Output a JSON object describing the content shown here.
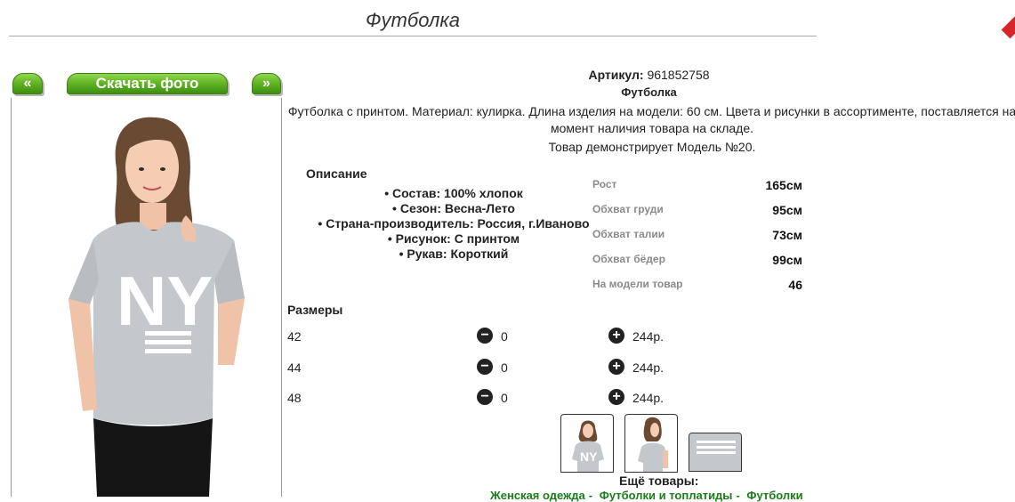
{
  "page": {
    "title": "Футболка"
  },
  "gallery": {
    "prev_label": "«",
    "download_label": "Скачать фото",
    "next_label": "»"
  },
  "product": {
    "article_label": "Артикул:",
    "article_value": "961852758",
    "name": "Футболка",
    "description": "Футболка с принтом. Материал: кулирка. Длина изделия на модели: 60 см. Цвета и рисунки в ассортименте, поставляется на момент наличия товара на складе.",
    "model_note": "Товар демонстрирует Модель №20."
  },
  "details": {
    "title": "Описание",
    "features": [
      "Состав: 100% хлопок",
      "Сезон: Весна-Лето",
      "Страна-производитель: Россия, г.Иваново",
      "Рисунок: С принтом",
      "Рукав: Короткий"
    ]
  },
  "measurements": [
    {
      "label": "Рост",
      "value": "165см"
    },
    {
      "label": "Обхват груди",
      "value": "95см"
    },
    {
      "label": "Обхват талии",
      "value": "73см"
    },
    {
      "label": "Обхват бёдер",
      "value": "99см"
    },
    {
      "label": "На модели товар",
      "value": "46"
    }
  ],
  "sizes": {
    "title": "Размеры",
    "minus_symbol": "−",
    "plus_symbol": "+",
    "rows": [
      {
        "size": "42",
        "qty": "0",
        "price": "244р."
      },
      {
        "size": "44",
        "qty": "0",
        "price": "244р."
      },
      {
        "size": "48",
        "qty": "0",
        "price": "244р."
      }
    ]
  },
  "more": {
    "title": "Ещё товары:",
    "links": [
      "Женская одежда",
      "Футболки и топлатиды",
      "Футболки"
    ]
  },
  "colors": {
    "button_green": "#5fb221",
    "link_green": "#1a7d1a",
    "shirt_gray": "#c4c8cc",
    "accent_red": "#d7262b"
  }
}
